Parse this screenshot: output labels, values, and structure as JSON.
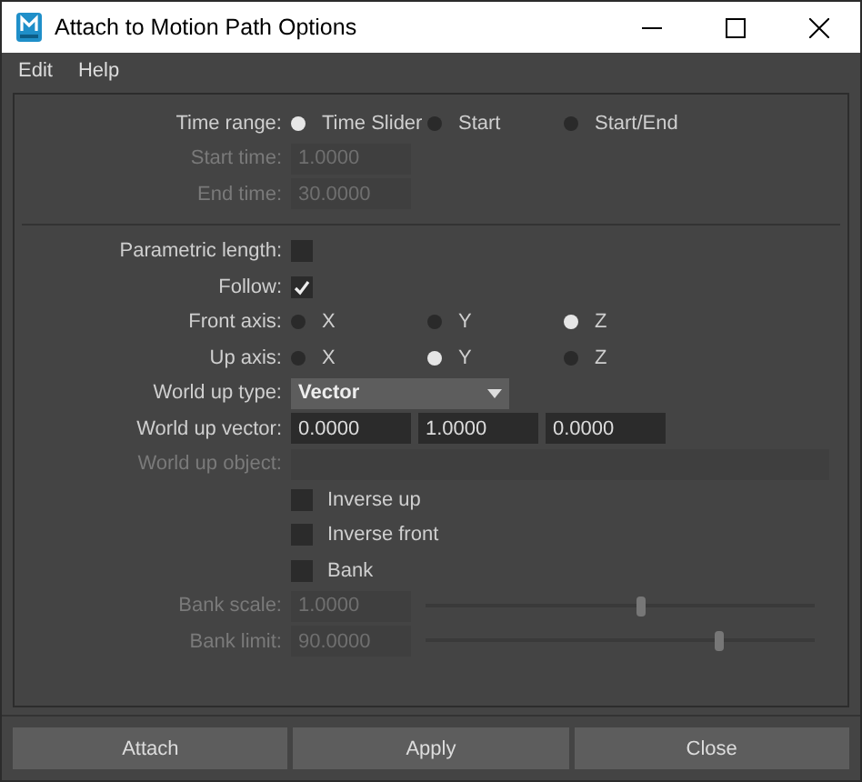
{
  "window": {
    "title": "Attach to Motion Path Options"
  },
  "menu": [
    "Edit",
    "Help"
  ],
  "sections": [
    {
      "rows": [
        {
          "kind": "radio",
          "label": "Time range:",
          "options": [
            {
              "label": "Time Slider",
              "selected": true
            },
            {
              "label": "Start",
              "selected": false
            },
            {
              "label": "Start/End",
              "selected": false
            }
          ]
        },
        {
          "kind": "field",
          "label": "Start time:",
          "disabled": true,
          "values": [
            "1.0000"
          ]
        },
        {
          "kind": "field",
          "label": "End time:",
          "disabled": true,
          "values": [
            "30.0000"
          ]
        }
      ]
    },
    {
      "rows": [
        {
          "kind": "checkbox",
          "label": "Parametric length:",
          "checked": false
        },
        {
          "kind": "checkbox",
          "label": "Follow:",
          "checked": true
        },
        {
          "kind": "radio",
          "label": "Front axis:",
          "options": [
            {
              "label": "X",
              "selected": false
            },
            {
              "label": "Y",
              "selected": false
            },
            {
              "label": "Z",
              "selected": true
            }
          ]
        },
        {
          "kind": "radio",
          "label": "Up axis:",
          "options": [
            {
              "label": "X",
              "selected": false
            },
            {
              "label": "Y",
              "selected": true
            },
            {
              "label": "Z",
              "selected": false
            }
          ]
        },
        {
          "kind": "dropdown",
          "label": "World up type:",
          "value": "Vector"
        },
        {
          "kind": "field",
          "label": "World up vector:",
          "disabled": false,
          "values": [
            "0.0000",
            "1.0000",
            "0.0000"
          ]
        },
        {
          "kind": "object_field",
          "label": "World up object:",
          "disabled": true
        },
        {
          "kind": "check_text",
          "text": "Inverse up",
          "checked": false
        },
        {
          "kind": "check_text",
          "text": "Inverse front",
          "checked": false
        },
        {
          "kind": "check_text",
          "text": "Bank",
          "checked": false
        },
        {
          "kind": "slider",
          "label": "Bank scale:",
          "value": "1.0000",
          "level": 0.55,
          "disabled": true
        },
        {
          "kind": "slider",
          "label": "Bank limit:",
          "value": "90.0000",
          "level": 0.75,
          "disabled": true
        }
      ]
    }
  ],
  "buttons": [
    "Attach",
    "Apply",
    "Close"
  ]
}
